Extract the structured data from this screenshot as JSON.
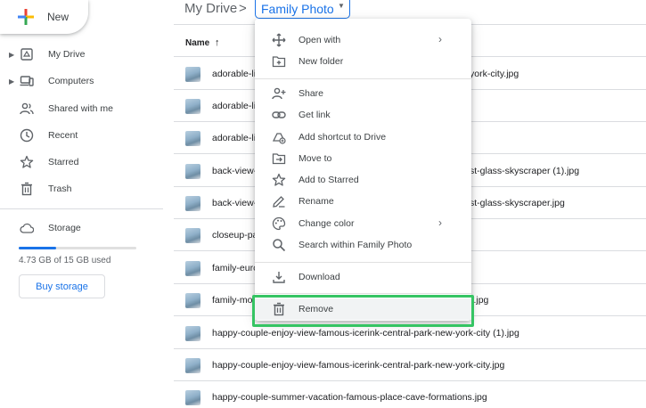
{
  "sidebar": {
    "new_label": "New",
    "items": [
      {
        "label": "My Drive",
        "icon": "my-drive-icon",
        "caret": true
      },
      {
        "label": "Computers",
        "icon": "computers-icon",
        "caret": true
      },
      {
        "label": "Shared with me",
        "icon": "shared-icon",
        "caret": false
      },
      {
        "label": "Recent",
        "icon": "clock-icon",
        "caret": false
      },
      {
        "label": "Starred",
        "icon": "star-icon",
        "caret": false
      },
      {
        "label": "Trash",
        "icon": "trash-icon",
        "caret": false
      }
    ],
    "storage_label": "Storage",
    "storage_used_text": "4.73 GB of 15 GB used",
    "storage_fraction": 0.315,
    "buy_storage_label": "Buy storage"
  },
  "header": {
    "root": "My Drive",
    "separator": ">",
    "current_folder": "Family Photo"
  },
  "list": {
    "name_header": "Name",
    "sort_icon": "arrow-up-icon",
    "rows": [
      {
        "left": "adorable-lit",
        "right": "york-city.jpg"
      },
      {
        "left": "adorable-lit",
        "right": ""
      },
      {
        "left": "adorable-lit",
        "right": ""
      },
      {
        "left": "back-view-",
        "right": "st-glass-skyscraper (1).jpg"
      },
      {
        "left": "back-view-",
        "right": "st-glass-skyscraper.jpg"
      },
      {
        "left": "closeup-pa",
        "right": ""
      },
      {
        "left": "family-eurc",
        "right": ""
      },
      {
        "left": "family-mo",
        "right": "y.jpg"
      },
      {
        "left": "happy-couple-enjoy-view-famous-icerink-central-park-new-york-city (1).jpg",
        "right": ""
      },
      {
        "left": "happy-couple-enjoy-view-famous-icerink-central-park-new-york-city.jpg",
        "right": ""
      },
      {
        "left": "happy-couple-summer-vacation-famous-place-cave-formations.jpg",
        "right": ""
      }
    ]
  },
  "menu": {
    "items": [
      {
        "label": "Open with",
        "icon": "open-with-icon",
        "submenu": true
      },
      {
        "label": "New folder",
        "icon": "new-folder-icon",
        "submenu": false
      },
      {
        "label": "Share",
        "icon": "share-icon",
        "submenu": false
      },
      {
        "label": "Get link",
        "icon": "link-icon",
        "submenu": false
      },
      {
        "label": "Add shortcut to Drive",
        "icon": "add-shortcut-icon",
        "submenu": false
      },
      {
        "label": "Move to",
        "icon": "move-to-icon",
        "submenu": false
      },
      {
        "label": "Add to Starred",
        "icon": "star-icon",
        "submenu": false
      },
      {
        "label": "Rename",
        "icon": "rename-icon",
        "submenu": false
      },
      {
        "label": "Change color",
        "icon": "palette-icon",
        "submenu": true
      },
      {
        "label": "Search within Family Photo",
        "icon": "search-icon",
        "submenu": false
      },
      {
        "label": "Download",
        "icon": "download-icon",
        "submenu": false
      },
      {
        "label": "Remove",
        "icon": "trash-icon",
        "submenu": false
      }
    ],
    "submenu_glyph": "›"
  },
  "colors": {
    "accent": "#1a73e8",
    "highlight": "#35c463"
  }
}
